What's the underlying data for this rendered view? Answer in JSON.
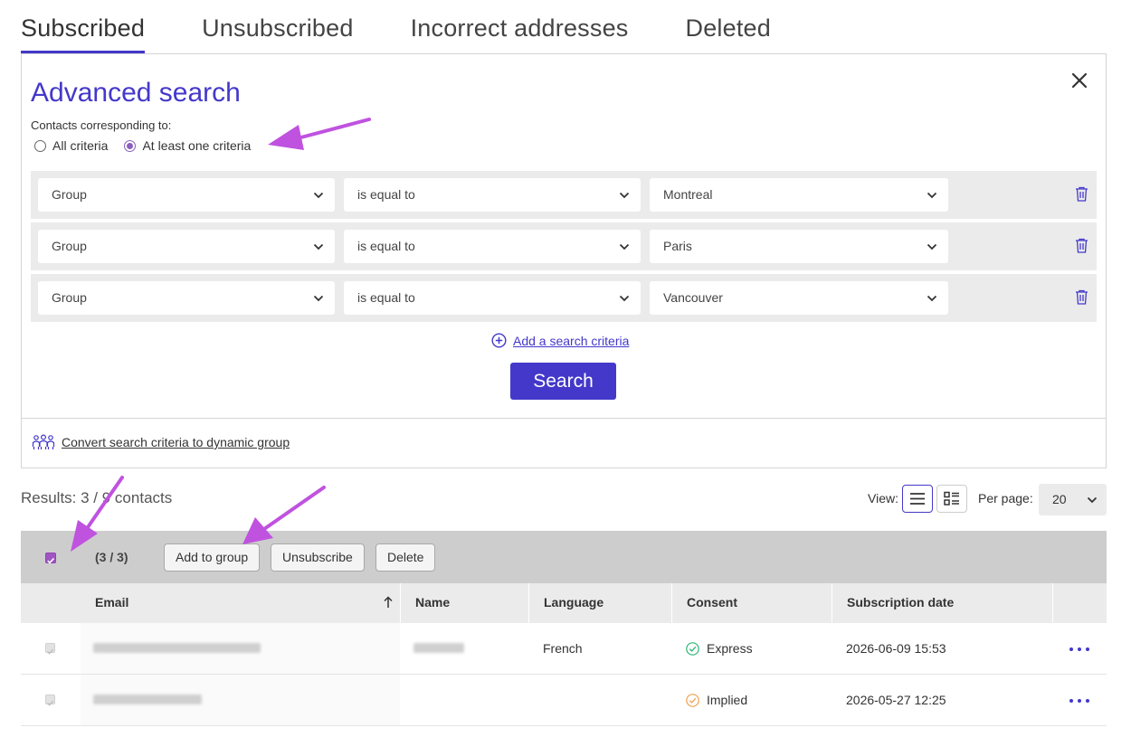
{
  "tabs": [
    {
      "label": "Subscribed",
      "active": true
    },
    {
      "label": "Unsubscribed",
      "active": false
    },
    {
      "label": "Incorrect addresses",
      "active": false
    },
    {
      "label": "Deleted",
      "active": false
    }
  ],
  "advanced_search": {
    "title": "Advanced search",
    "match_label": "Contacts corresponding to:",
    "options": {
      "all": "All criteria",
      "any": "At least one criteria",
      "selected": "any"
    },
    "criteria": [
      {
        "field": "Group",
        "operator": "is equal to",
        "value": "Montreal"
      },
      {
        "field": "Group",
        "operator": "is equal to",
        "value": "Paris"
      },
      {
        "field": "Group",
        "operator": "is equal to",
        "value": "Vancouver"
      }
    ],
    "add_criteria_label": "Add a search criteria",
    "search_button": "Search",
    "convert_label": "Convert search criteria to dynamic group"
  },
  "results": {
    "label": "Results: 3 / 9 contacts",
    "view_label": "View:",
    "per_page_label": "Per page:",
    "per_page_value": "20"
  },
  "bulk": {
    "count": "(3 / 3)",
    "add_to_group": "Add to group",
    "unsubscribe": "Unsubscribe",
    "delete": "Delete"
  },
  "table": {
    "headers": {
      "email": "Email",
      "name": "Name",
      "language": "Language",
      "consent": "Consent",
      "subscription_date": "Subscription date"
    },
    "rows": [
      {
        "language": "French",
        "consent": "Express",
        "subscription_date": "2026-06-09 15:53"
      },
      {
        "language": "",
        "consent": "Implied",
        "subscription_date": "2026-05-27 12:25"
      }
    ]
  },
  "colors": {
    "accent": "#4338ca",
    "annotation": "#c052e0",
    "consent_express": "#2bb673",
    "consent_implied": "#f0a04b"
  }
}
